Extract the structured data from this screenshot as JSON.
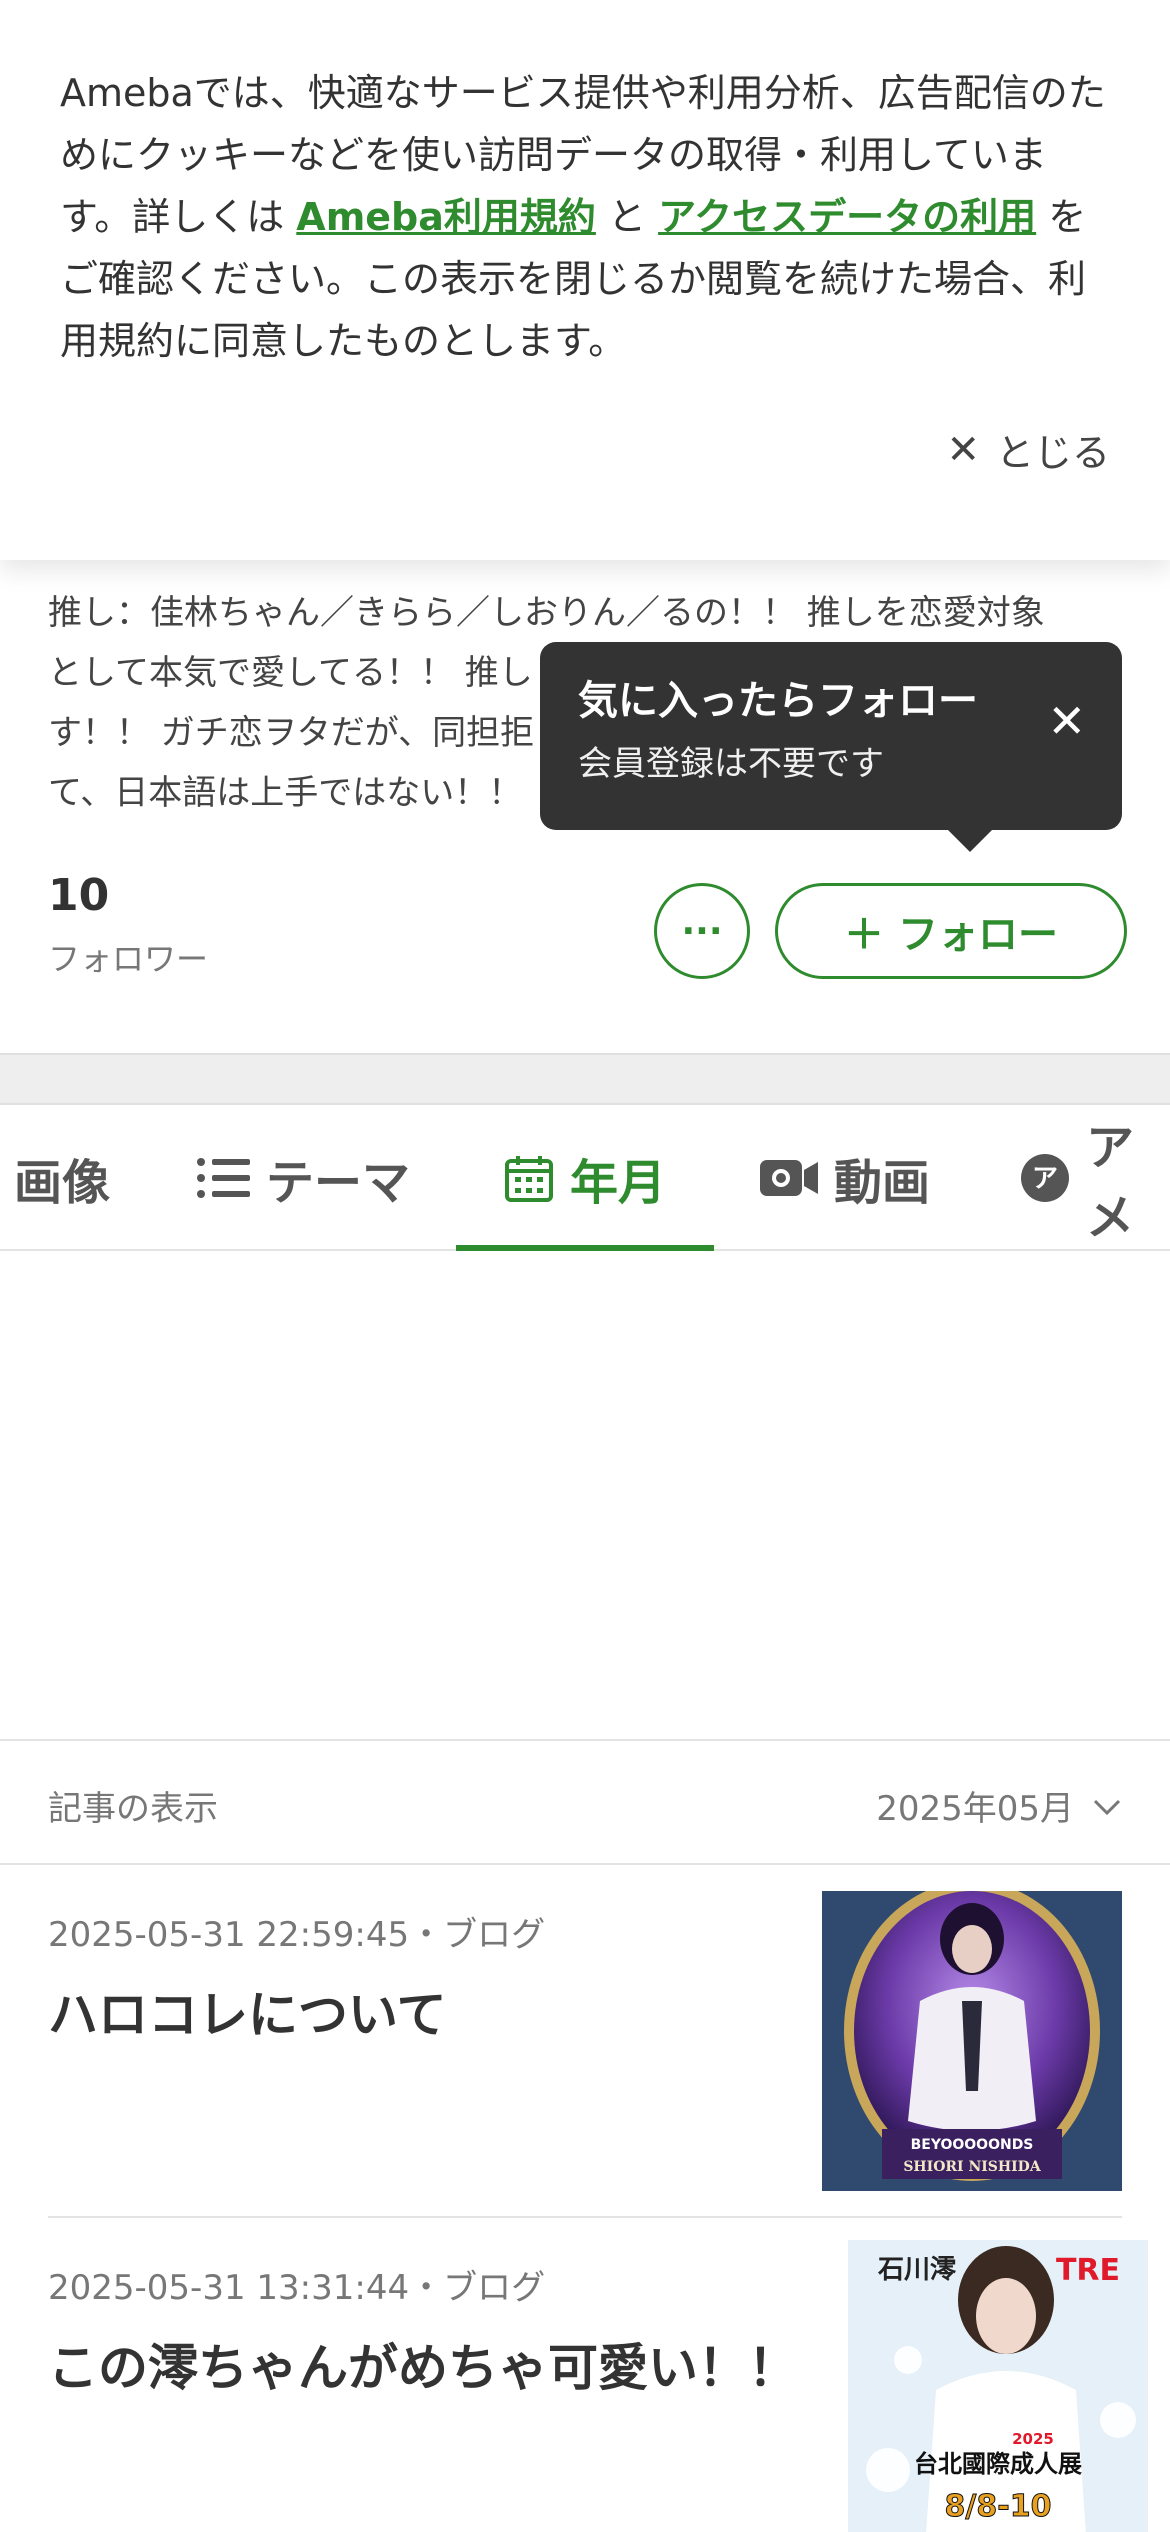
{
  "cookie": {
    "text_1": "Amebaでは、快適なサービス提供や利用分析、広告配信のためにクッキーなどを使い訪問データの取得・利用しています。詳しくは ",
    "link_terms": "Ameba利用規約",
    "text_and": " と ",
    "link_access": "アクセスデータの利用",
    "text_2": " をご確認ください。この表示を閉じるか閲覧を続けた場合、利用規約に同意したものとします。",
    "close_label": "とじる"
  },
  "profile": {
    "bio_line_1": "推し：佳林ちゃん／きらら／しおりん／るの！！ 推しを恋愛対象",
    "bio_line_2": "として本気で愛してる！！ 推し",
    "bio_line_3": "す！！ ガチ恋ヲタだが、同担拒",
    "bio_line_4": "て、日本語は上手ではない！！",
    "followers_count": "10",
    "followers_label": "フォロワー",
    "more_label": "···",
    "follow_label": "フォロー"
  },
  "tooltip": {
    "title": "気に入ったらフォロー",
    "subtitle": "会員登録は不要です"
  },
  "tabs": [
    {
      "label": "画像",
      "icon": "image-icon"
    },
    {
      "label": "テーマ",
      "icon": "list-icon"
    },
    {
      "label": "年月",
      "icon": "calendar-icon",
      "active": true
    },
    {
      "label": "動画",
      "icon": "video-icon"
    },
    {
      "label": "アメ",
      "icon": "ameba-icon"
    }
  ],
  "display": {
    "label": "記事の表示",
    "value": "2025年05月"
  },
  "articles": [
    {
      "meta": "2025-05-31 22:59:45・ブログ",
      "title": "ハロコレについて",
      "thumb_caption": "SHIORI NISHIDA",
      "thumb_logo": "BEYOOOOONDS"
    },
    {
      "meta": "2025-05-31 13:31:44・ブログ",
      "title": "この澪ちゃんがめちゃ可愛い！！",
      "thumb_name": "石川澪",
      "thumb_badge": "TRE",
      "thumb_event": "台北國際成人展",
      "thumb_year": "2025",
      "thumb_date": "8/8-10"
    }
  ],
  "colors": {
    "accent": "#2e8b2e",
    "tooltip_bg": "#333333"
  }
}
